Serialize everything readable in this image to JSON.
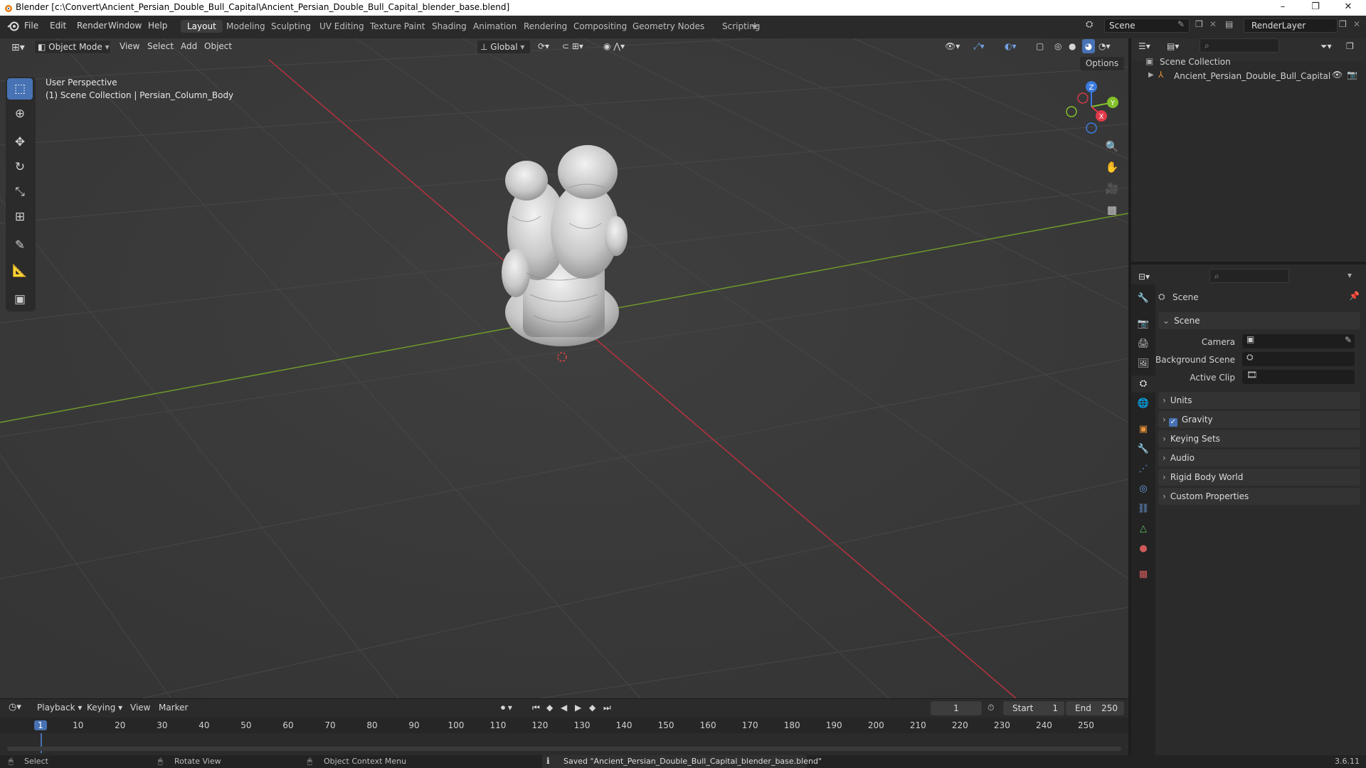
{
  "window": {
    "title": "Blender [c:\\Convert\\Ancient_Persian_Double_Bull_Capital\\Ancient_Persian_Double_Bull_Capital_blender_base.blend]",
    "minimize": "–",
    "maximize": "❐",
    "close": "✕"
  },
  "menu": [
    "File",
    "Edit",
    "Render",
    "Window",
    "Help"
  ],
  "workspaces": [
    "Layout",
    "Modeling",
    "Sculpting",
    "UV Editing",
    "Texture Paint",
    "Shading",
    "Animation",
    "Rendering",
    "Compositing",
    "Geometry Nodes",
    "Scripting",
    "+"
  ],
  "scene_field": "Scene",
  "renderlayer_field": "RenderLayer",
  "viewport_header": {
    "mode": "Object Mode",
    "menus": [
      "View",
      "Select",
      "Add",
      "Object"
    ],
    "orientation": "Global",
    "options": "Options"
  },
  "viewport": {
    "perspective": "User Perspective",
    "collection_info": "(1) Scene Collection | Persian_Column_Body",
    "gizmo": {
      "z": "Z",
      "y": "Y",
      "x": "X"
    }
  },
  "tools": [
    "select-box-tool",
    "cursor-tool",
    "move-tool",
    "rotate-tool",
    "scale-tool",
    "transform-tool",
    "annotate-tool",
    "measure-tool",
    "add-cube-tool"
  ],
  "outliner": {
    "root": "Scene Collection",
    "items": [
      "Ancient_Persian_Double_Bull_Capital"
    ]
  },
  "properties": {
    "header": "Scene",
    "section": "Scene",
    "camera_label": "Camera",
    "background_label": "Background Scene",
    "clip_label": "Active Clip",
    "sections": [
      "Units",
      "Gravity",
      "Keying Sets",
      "Audio",
      "Rigid Body World",
      "Custom Properties"
    ]
  },
  "timeline": {
    "menus": [
      "Playback",
      "Keying",
      "View",
      "Marker"
    ],
    "current_frame": "1",
    "start_label": "Start",
    "start": "1",
    "end_label": "End",
    "end": "250",
    "frames": [
      "1",
      "10",
      "20",
      "30",
      "40",
      "50",
      "60",
      "70",
      "80",
      "90",
      "100",
      "110",
      "120",
      "130",
      "140",
      "150",
      "160",
      "170",
      "180",
      "190",
      "200",
      "210",
      "220",
      "230",
      "240",
      "250"
    ]
  },
  "status": {
    "select": "Select",
    "rotate": "Rotate View",
    "context": "Object Context Menu",
    "message": "Saved \"Ancient_Persian_Double_Bull_Capital_blender_base.blend\"",
    "version": "3.6.11"
  },
  "colors": {
    "accent": "#4772b3",
    "x_axis": "#e03a4a",
    "y_axis": "#83c02a",
    "z_axis": "#3b7be0"
  }
}
